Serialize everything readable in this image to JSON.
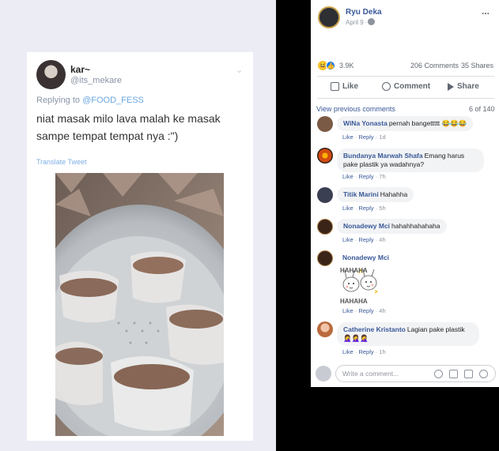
{
  "tweet": {
    "name": "kar~",
    "handle": "@its_mekare",
    "replying_prefix": "Replying to ",
    "replying_to": "@FOOD_FESS",
    "text": "niat masak milo lava malah ke masak sampe tempat tempat nya :\")",
    "translate": "Translate Tweet"
  },
  "post": {
    "author": "Ryu Deka",
    "date": "April 9 ·",
    "more": "...",
    "reactions_count": "3.9K",
    "comments_count": "206 Comments",
    "shares_count": "35 Shares",
    "actions": {
      "like": "Like",
      "comment": "Comment",
      "share": "Share"
    },
    "view_previous": "View previous comments",
    "page_count": "6 of 140"
  },
  "comments": [
    {
      "name": "WiNa Yonasta",
      "text": "pernah bangettttt 😂😂😂",
      "like": "Like",
      "reply": "Reply",
      "time": "1d",
      "color": "#7a5a45"
    },
    {
      "name": "Bundanya Marwah Shafa",
      "text": "Emang harus pake plastik ya wadahnya?",
      "like": "Like",
      "reply": "Reply",
      "time": "7h",
      "color": "#d14a12"
    },
    {
      "name": "Titik Marini",
      "text": "Hahahha",
      "like": "Like",
      "reply": "Reply",
      "time": "5h",
      "color": "#3b3f52"
    },
    {
      "name": "Nonadewy Mci",
      "text": "hahahhahahaha",
      "like": "Like",
      "reply": "Reply",
      "time": "4h",
      "color": "#3a2418"
    },
    {
      "name": "Nonadewy Mci",
      "text": "",
      "sticker_text": "HAHAHA",
      "like": "Like",
      "reply": "Reply",
      "time": "4h",
      "color": "#3a2418"
    },
    {
      "name": "Catherine Kristanto",
      "text": "Lagian pake plastik 🤦‍♀️🤦‍♀️🤦‍♀️",
      "like": "Like",
      "reply": "Reply",
      "time": "1h",
      "color": "#b96a3c"
    }
  ],
  "composer": {
    "placeholder": "Write a comment..."
  },
  "colors": {
    "fb_link": "#385898",
    "bubble": "#f2f3f5",
    "tw_link": "#6aa6e0"
  }
}
